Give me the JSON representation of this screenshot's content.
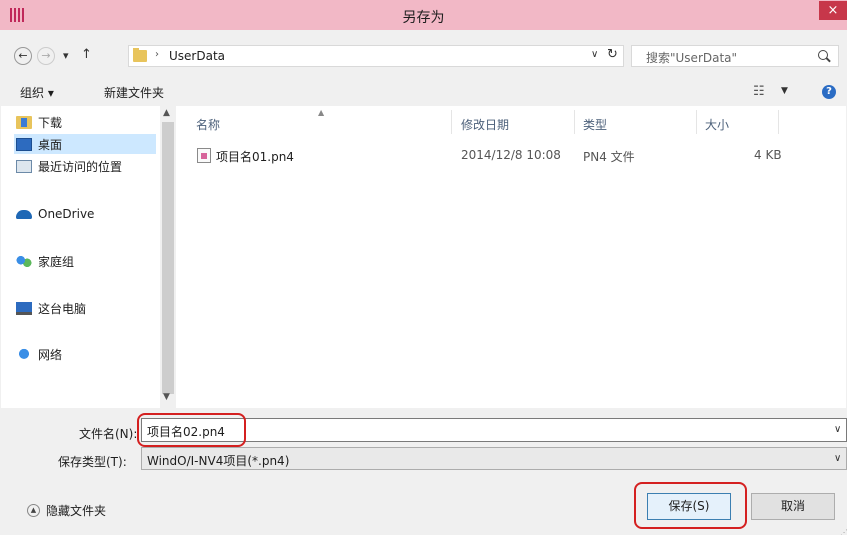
{
  "window": {
    "title": "另存为",
    "close": "×"
  },
  "address": {
    "crumb": "UserData",
    "sep": "›",
    "back": "←",
    "forward": "→",
    "recent": "▾",
    "up": "↑",
    "dropdown": "∨",
    "refresh": "↻"
  },
  "search": {
    "placeholder": "搜索\"UserData\""
  },
  "toolbar": {
    "organize": "组织 ▾",
    "new_folder": "新建文件夹",
    "view": "☷",
    "view_dd": "▼",
    "help": "?"
  },
  "nav": {
    "items": [
      {
        "label": "下载",
        "icon": "download-folder-icon"
      },
      {
        "label": "桌面",
        "icon": "desktop-icon"
      },
      {
        "label": "最近访问的位置",
        "icon": "recent-places-icon"
      },
      {
        "label": "OneDrive",
        "icon": "onedrive-icon"
      },
      {
        "label": "家庭组",
        "icon": "homegroup-icon"
      },
      {
        "label": "这台电脑",
        "icon": "this-pc-icon"
      },
      {
        "label": "网络",
        "icon": "network-icon"
      }
    ],
    "scroll_up": "▲",
    "scroll_down": "▼"
  },
  "columns": {
    "name": "名称",
    "date": "修改日期",
    "type": "类型",
    "size": "大小",
    "sort_arrow": "▲"
  },
  "files": [
    {
      "name": "项目名01.pn4",
      "date": "2014/12/8 10:08",
      "type": "PN4 文件",
      "size": "4 KB"
    }
  ],
  "form": {
    "name_label": "文件名(N):",
    "name_value": "项目名02.pn4",
    "type_label": "保存类型(T):",
    "type_value": "WindO/I-NV4项目(*.pn4)",
    "dropdown": "∨"
  },
  "footer": {
    "hide_folders": "隐藏文件夹",
    "hide_icon": "▲",
    "save": "保存(S)",
    "cancel": "取消"
  },
  "colors": {
    "titlebar": "#f2b8c6",
    "close": "#c7374a",
    "selected": "#cde8ff",
    "highlight_ring": "#d42020"
  }
}
